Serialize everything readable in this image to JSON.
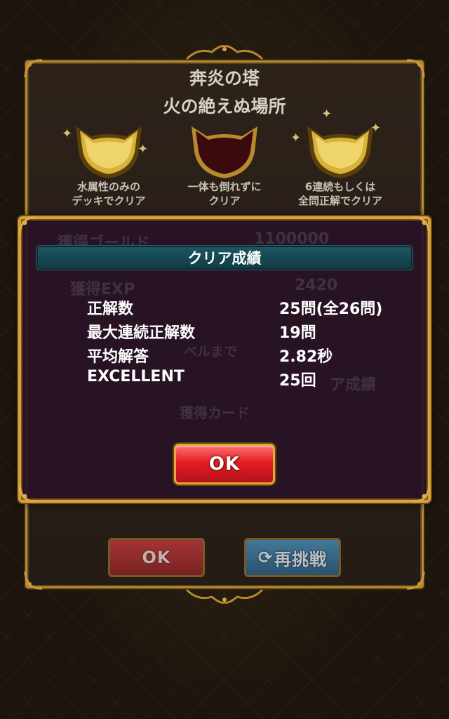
{
  "stage": {
    "name": "奔炎の塔",
    "subtitle": "火の絶えぬ場所"
  },
  "medals": [
    {
      "condition_line1": "水属性のみの",
      "condition_line2": "デッキでクリア",
      "status": "earned",
      "icon": "cat-medal-gold-icon"
    },
    {
      "condition_line1": "一体も倒れずに",
      "condition_line2": "クリア",
      "status": "not-earned",
      "icon": "cat-medal-empty-icon"
    },
    {
      "condition_line1": "6連続もしくは",
      "condition_line2": "全問正解でクリア",
      "status": "earned",
      "icon": "cat-medal-gold-icon"
    }
  ],
  "background_rewards": {
    "gold_label": "獲得ゴールド",
    "gold_value": "1100000",
    "exp_label": "獲得EXP",
    "exp_value": "2420",
    "level_text": "ベルまで",
    "clear_record_link": "ア成績",
    "cards_header": "獲得カード"
  },
  "back_buttons": {
    "ok_label": "OK",
    "retry_label": "再挑戦",
    "retry_icon": "refresh-icon"
  },
  "dialog": {
    "title": "クリア成績",
    "stats": [
      {
        "label": "正解数",
        "value": "25問(全26問)"
      },
      {
        "label": "最大連続正解数",
        "value": "19問"
      },
      {
        "label": "平均解答",
        "value": "2.82秒"
      },
      {
        "label": "EXCELLENT",
        "value": "25回"
      }
    ],
    "ok_label": "OK"
  },
  "colors": {
    "gold_frame": "#d6a23e",
    "dialog_bg": "#281226",
    "header_teal": "#1e5863",
    "ok_red": "#e51d24",
    "retry_blue": "#4a8fb8"
  }
}
